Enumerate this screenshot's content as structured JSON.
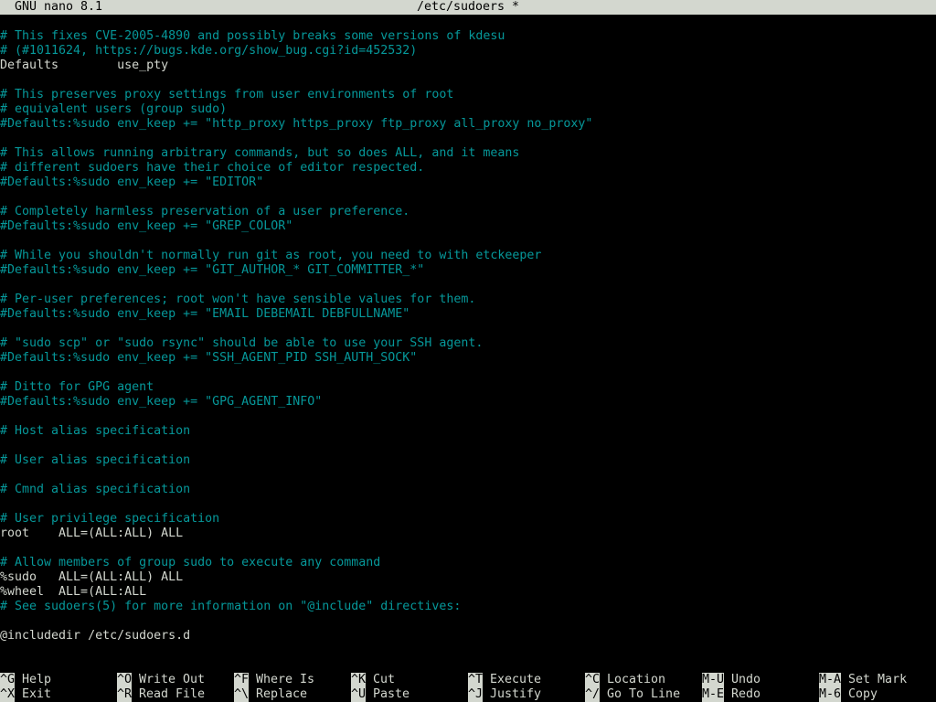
{
  "titlebar": {
    "app": "GNU nano 8.1",
    "file": "/etc/sudoers *"
  },
  "lines": [
    {
      "text": "# This fixes CVE-2005-4890 and possibly breaks some versions of kdesu",
      "type": "comment"
    },
    {
      "text": "# (#1011624, https://bugs.kde.org/show_bug.cgi?id=452532)",
      "type": "comment"
    },
    {
      "text": "Defaults        use_pty",
      "type": "text"
    },
    {
      "text": "",
      "type": "text"
    },
    {
      "text": "# This preserves proxy settings from user environments of root",
      "type": "comment"
    },
    {
      "text": "# equivalent users (group sudo)",
      "type": "comment"
    },
    {
      "text": "#Defaults:%sudo env_keep += \"http_proxy https_proxy ftp_proxy all_proxy no_proxy\"",
      "type": "comment"
    },
    {
      "text": "",
      "type": "text"
    },
    {
      "text": "# This allows running arbitrary commands, but so does ALL, and it means",
      "type": "comment"
    },
    {
      "text": "# different sudoers have their choice of editor respected.",
      "type": "comment"
    },
    {
      "text": "#Defaults:%sudo env_keep += \"EDITOR\"",
      "type": "comment"
    },
    {
      "text": "",
      "type": "text"
    },
    {
      "text": "# Completely harmless preservation of a user preference.",
      "type": "comment"
    },
    {
      "text": "#Defaults:%sudo env_keep += \"GREP_COLOR\"",
      "type": "comment"
    },
    {
      "text": "",
      "type": "text"
    },
    {
      "text": "# While you shouldn't normally run git as root, you need to with etckeeper",
      "type": "comment"
    },
    {
      "text": "#Defaults:%sudo env_keep += \"GIT_AUTHOR_* GIT_COMMITTER_*\"",
      "type": "comment"
    },
    {
      "text": "",
      "type": "text"
    },
    {
      "text": "# Per-user preferences; root won't have sensible values for them.",
      "type": "comment"
    },
    {
      "text": "#Defaults:%sudo env_keep += \"EMAIL DEBEMAIL DEBFULLNAME\"",
      "type": "comment"
    },
    {
      "text": "",
      "type": "text"
    },
    {
      "text": "# \"sudo scp\" or \"sudo rsync\" should be able to use your SSH agent.",
      "type": "comment"
    },
    {
      "text": "#Defaults:%sudo env_keep += \"SSH_AGENT_PID SSH_AUTH_SOCK\"",
      "type": "comment"
    },
    {
      "text": "",
      "type": "text"
    },
    {
      "text": "# Ditto for GPG agent",
      "type": "comment"
    },
    {
      "text": "#Defaults:%sudo env_keep += \"GPG_AGENT_INFO\"",
      "type": "comment"
    },
    {
      "text": "",
      "type": "text"
    },
    {
      "text": "# Host alias specification",
      "type": "comment"
    },
    {
      "text": "",
      "type": "text"
    },
    {
      "text": "# User alias specification",
      "type": "comment"
    },
    {
      "text": "",
      "type": "text"
    },
    {
      "text": "# Cmnd alias specification",
      "type": "comment"
    },
    {
      "text": "",
      "type": "text"
    },
    {
      "text": "# User privilege specification",
      "type": "comment"
    },
    {
      "text": "root    ALL=(ALL:ALL) ALL",
      "type": "text"
    },
    {
      "text": "",
      "type": "text"
    },
    {
      "text": "# Allow members of group sudo to execute any command",
      "type": "comment"
    },
    {
      "text": "%sudo   ALL=(ALL:ALL) ALL",
      "type": "text"
    },
    {
      "text": "%wheel  ALL=(ALL:ALL",
      "type": "text"
    },
    {
      "text": "# See sudoers(5) for more information on \"@include\" directives:",
      "type": "comment"
    },
    {
      "text": "",
      "type": "text"
    },
    {
      "text": "@includedir /etc/sudoers.d",
      "type": "text"
    }
  ],
  "shortcuts": [
    {
      "key": "^G",
      "label": "Help",
      "name": "help"
    },
    {
      "key": "^O",
      "label": "Write Out",
      "name": "write-out"
    },
    {
      "key": "^F",
      "label": "Where Is",
      "name": "where-is"
    },
    {
      "key": "^K",
      "label": "Cut",
      "name": "cut"
    },
    {
      "key": "^T",
      "label": "Execute",
      "name": "execute"
    },
    {
      "key": "^C",
      "label": "Location",
      "name": "location"
    },
    {
      "key": "M-U",
      "label": "Undo",
      "name": "undo"
    },
    {
      "key": "M-A",
      "label": "Set Mark",
      "name": "set-mark"
    },
    {
      "key": "^X",
      "label": "Exit",
      "name": "exit"
    },
    {
      "key": "^R",
      "label": "Read File",
      "name": "read-file"
    },
    {
      "key": "^\\",
      "label": "Replace",
      "name": "replace"
    },
    {
      "key": "^U",
      "label": "Paste",
      "name": "paste"
    },
    {
      "key": "^J",
      "label": "Justify",
      "name": "justify"
    },
    {
      "key": "^/",
      "label": "Go To Line",
      "name": "go-to-line"
    },
    {
      "key": "M-E",
      "label": "Redo",
      "name": "redo"
    },
    {
      "key": "M-6",
      "label": "Copy",
      "name": "copy"
    }
  ],
  "colors": {
    "comment": "#06989a",
    "text": "#d3d7cf",
    "background": "#000000",
    "inverse_bg": "#d3d7cf"
  }
}
